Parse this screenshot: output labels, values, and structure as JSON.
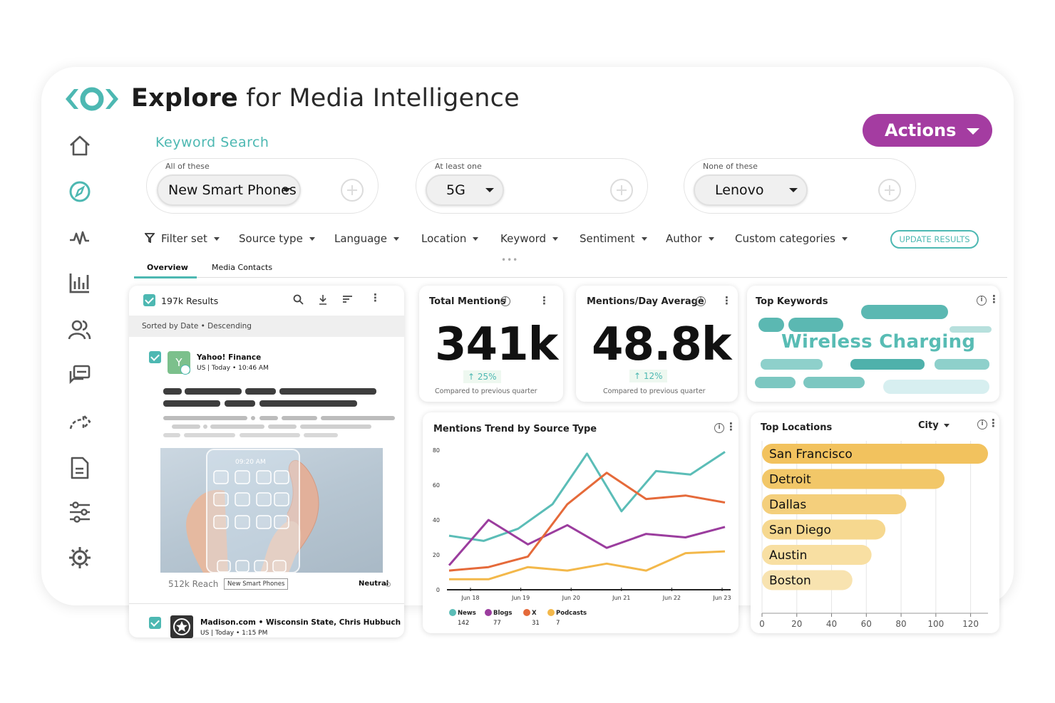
{
  "app": {
    "title_bold": "Explore",
    "title_rest": " for Media Intelligence",
    "actions_label": "Actions"
  },
  "nav": [
    "home-icon",
    "compass-icon",
    "pulse-icon",
    "bar-chart-icon",
    "users-icon",
    "chat-icon",
    "share-icon",
    "document-icon",
    "sliders-icon",
    "settings-icon"
  ],
  "keyword_search": {
    "title": "Keyword Search",
    "groups": [
      {
        "label": "All of these",
        "value": "New Smart Phones"
      },
      {
        "label": "At least one",
        "value": "5G"
      },
      {
        "label": "None of these",
        "value": "Lenovo"
      }
    ]
  },
  "filters": [
    "Filter set",
    "Source type",
    "Language",
    "Location",
    "Keyword",
    "Sentiment",
    "Author",
    "Custom categories"
  ],
  "update_label": "UPDATE RESULTS",
  "tabs": [
    "Overview",
    "Media Contacts"
  ],
  "results": {
    "count_label": "197k Results",
    "sorted_label": "Sorted by Date • Descending",
    "item1": {
      "avatar_letter": "Y",
      "source": "Yahoo! Finance",
      "meta": "US  | Today • 10:46 AM",
      "reach": "512k Reach",
      "tag": "New Smart Phones",
      "sentiment": "Neutral"
    },
    "item2": {
      "source": "Madison.com • Wisconsin State, Chris Hubbuch",
      "meta": "US | Today • 1:15 PM"
    },
    "phone_time": "09:20 AM"
  },
  "total_mentions": {
    "title": "Total Mentions",
    "value": "341k",
    "delta": "↑ 25%",
    "compare": "Compared to previous quarter"
  },
  "mentions_day": {
    "title": "Mentions/Day Average",
    "value": "48.8k",
    "delta": "↑ 12%",
    "compare": "Compared to previous quarter"
  },
  "top_keywords": {
    "title": "Top Keywords",
    "featured": "Wireless Charging"
  },
  "chart_data": [
    {
      "type": "line",
      "title": "Mentions Trend by Source Type",
      "x": [
        "Jun 18",
        "Jun 19",
        "Jun 20",
        "Jun 21",
        "Jun 22",
        "Jun 23"
      ],
      "ylim": [
        0,
        80
      ],
      "yticks": [
        0,
        20,
        40,
        60,
        80
      ],
      "series": [
        {
          "name": "News",
          "total": "142",
          "color": "#5bbdb7",
          "values": [
            31,
            28,
            35,
            49,
            78,
            45,
            68,
            66,
            79
          ]
        },
        {
          "name": "Blogs",
          "total": "77",
          "color": "#9b3d9e",
          "values": [
            14,
            40,
            26,
            37,
            24,
            32,
            30,
            36
          ]
        },
        {
          "name": "X",
          "total": "31",
          "color": "#e56a3a",
          "values": [
            11,
            13,
            19,
            49,
            67,
            52,
            54,
            50
          ]
        },
        {
          "name": "Podcasts",
          "total": "7",
          "color": "#f3b84a",
          "values": [
            6,
            6,
            13,
            11,
            15,
            11,
            21,
            22
          ]
        }
      ]
    },
    {
      "type": "bar",
      "title": "Top Locations",
      "dropdown": "City",
      "orientation": "horizontal",
      "categories": [
        "San Francisco",
        "Detroit",
        "Dallas",
        "San Diego",
        "Austin",
        "Boston"
      ],
      "values": [
        130,
        105,
        83,
        71,
        63,
        52
      ],
      "xlim": [
        0,
        130
      ],
      "xticks": [
        0,
        20,
        40,
        60,
        80,
        100,
        120
      ],
      "colors": [
        "#f2c25e",
        "#f2c768",
        "#f4cf7c",
        "#f6d88f",
        "#f8dfa2",
        "#f8e3b0"
      ]
    }
  ]
}
